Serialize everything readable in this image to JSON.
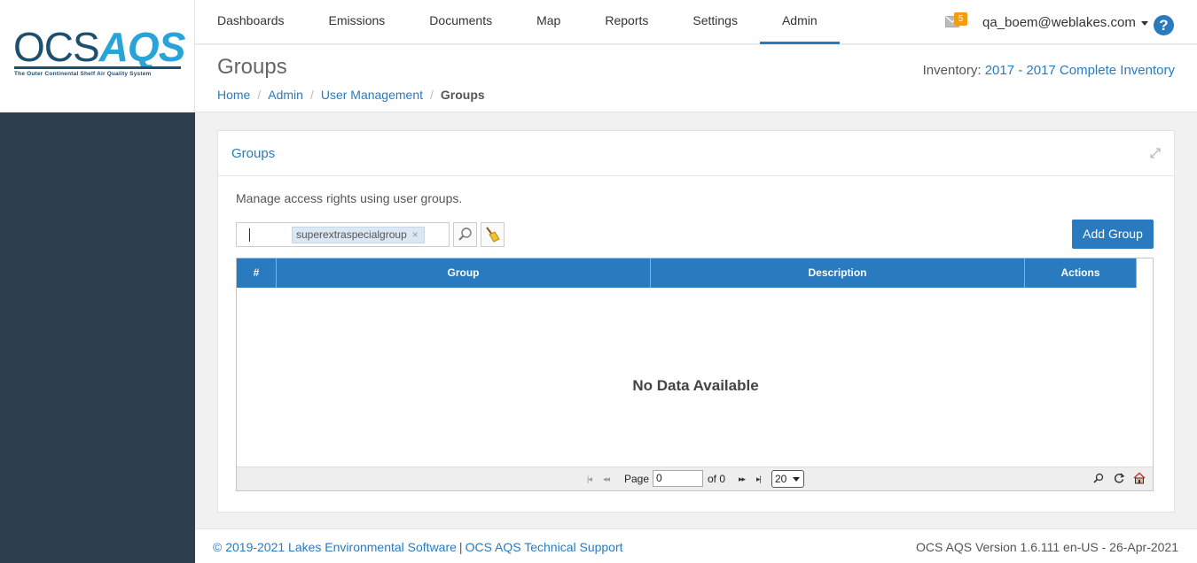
{
  "logo": {
    "part1": "OCS",
    "part2": "AQS",
    "tagline": "The Outer Continental Shelf Air Quality System"
  },
  "nav": {
    "items": [
      {
        "label": "Dashboards"
      },
      {
        "label": "Emissions"
      },
      {
        "label": "Documents"
      },
      {
        "label": "Map"
      },
      {
        "label": "Reports"
      },
      {
        "label": "Settings"
      },
      {
        "label": "Admin",
        "active": true
      }
    ],
    "mail_count": "5",
    "user": "qa_boem@weblakes.com",
    "help": "?"
  },
  "header": {
    "title": "Groups",
    "breadcrumb": [
      "Home",
      "Admin",
      "User Management",
      "Groups"
    ],
    "inventory_label": "Inventory:",
    "inventory_value": "2017 - 2017 Complete Inventory"
  },
  "panel": {
    "title": "Groups",
    "description": "Manage access rights using user groups.",
    "search_tag": "superextraspecialgroup",
    "tag_remove": "×",
    "add_button": "Add Group",
    "columns": [
      "#",
      "Group",
      "Description",
      "Actions"
    ],
    "rows": [],
    "empty_message": "No Data Available",
    "pager": {
      "page_label": "Page",
      "page_value": "0",
      "of_label": "of 0",
      "page_size": "20"
    }
  },
  "footer": {
    "copyright": "© 2019-2021 Lakes Environmental Software",
    "separator": "|",
    "support": "OCS AQS Technical Support",
    "version": "OCS AQS Version 1.6.111 en-US - 26-Apr-2021"
  },
  "colors": {
    "accent": "#2a7abf",
    "sidebar": "#2d3e4f",
    "badge": "#f39c12"
  }
}
